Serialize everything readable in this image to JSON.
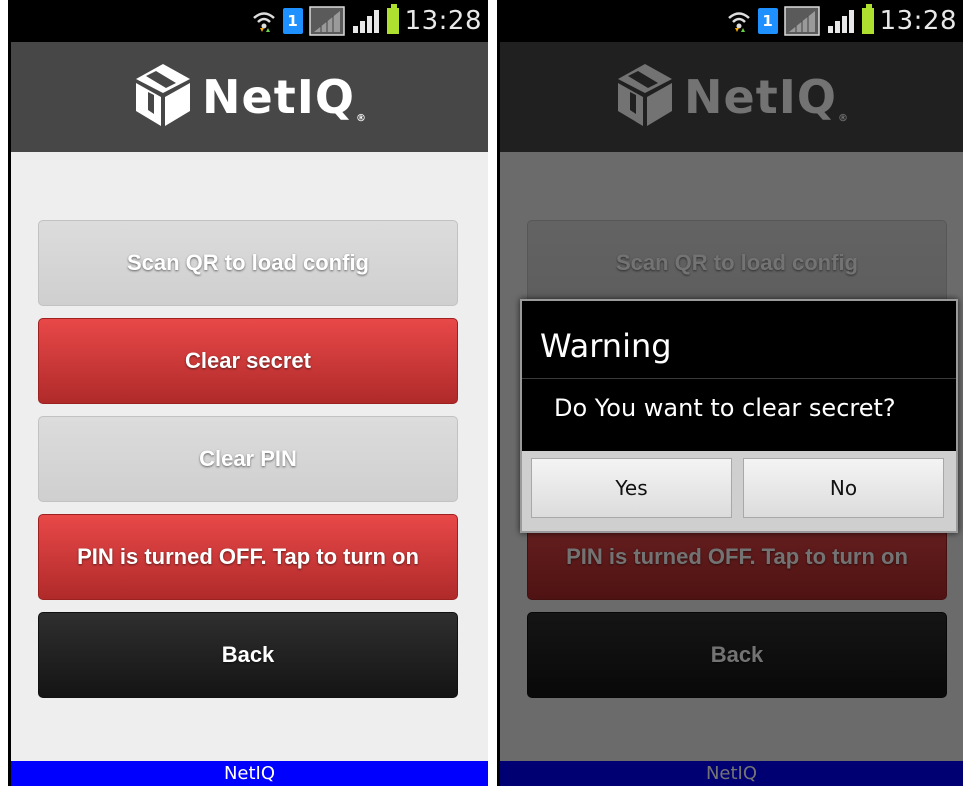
{
  "status_bar": {
    "time": "13:28",
    "sim_label": "1"
  },
  "header": {
    "logo_text": "NetIQ",
    "logo_mark": "®"
  },
  "buttons": {
    "scan_qr": "Scan QR to load config",
    "clear_secret": "Clear secret",
    "clear_pin": "Clear PIN",
    "pin_toggle": "PIN is turned OFF. Tap to turn on",
    "back": "Back"
  },
  "footer": {
    "label": "NetIQ"
  },
  "dialog": {
    "title": "Warning",
    "message": "Do You want to clear secret?",
    "yes_label": "Yes",
    "no_label": "No"
  },
  "colors": {
    "header_bg": "#474747",
    "content_bg": "#eeeeee",
    "button_red": "#e84848",
    "button_gray": "#dcdcdc",
    "button_black": "#1f1f1f",
    "footer_bg": "#0000ff"
  },
  "icons": [
    "wifi-icon",
    "sim-icon",
    "signal-icon",
    "signal-icon-2",
    "battery-icon",
    "netiq-logo-icon"
  ]
}
